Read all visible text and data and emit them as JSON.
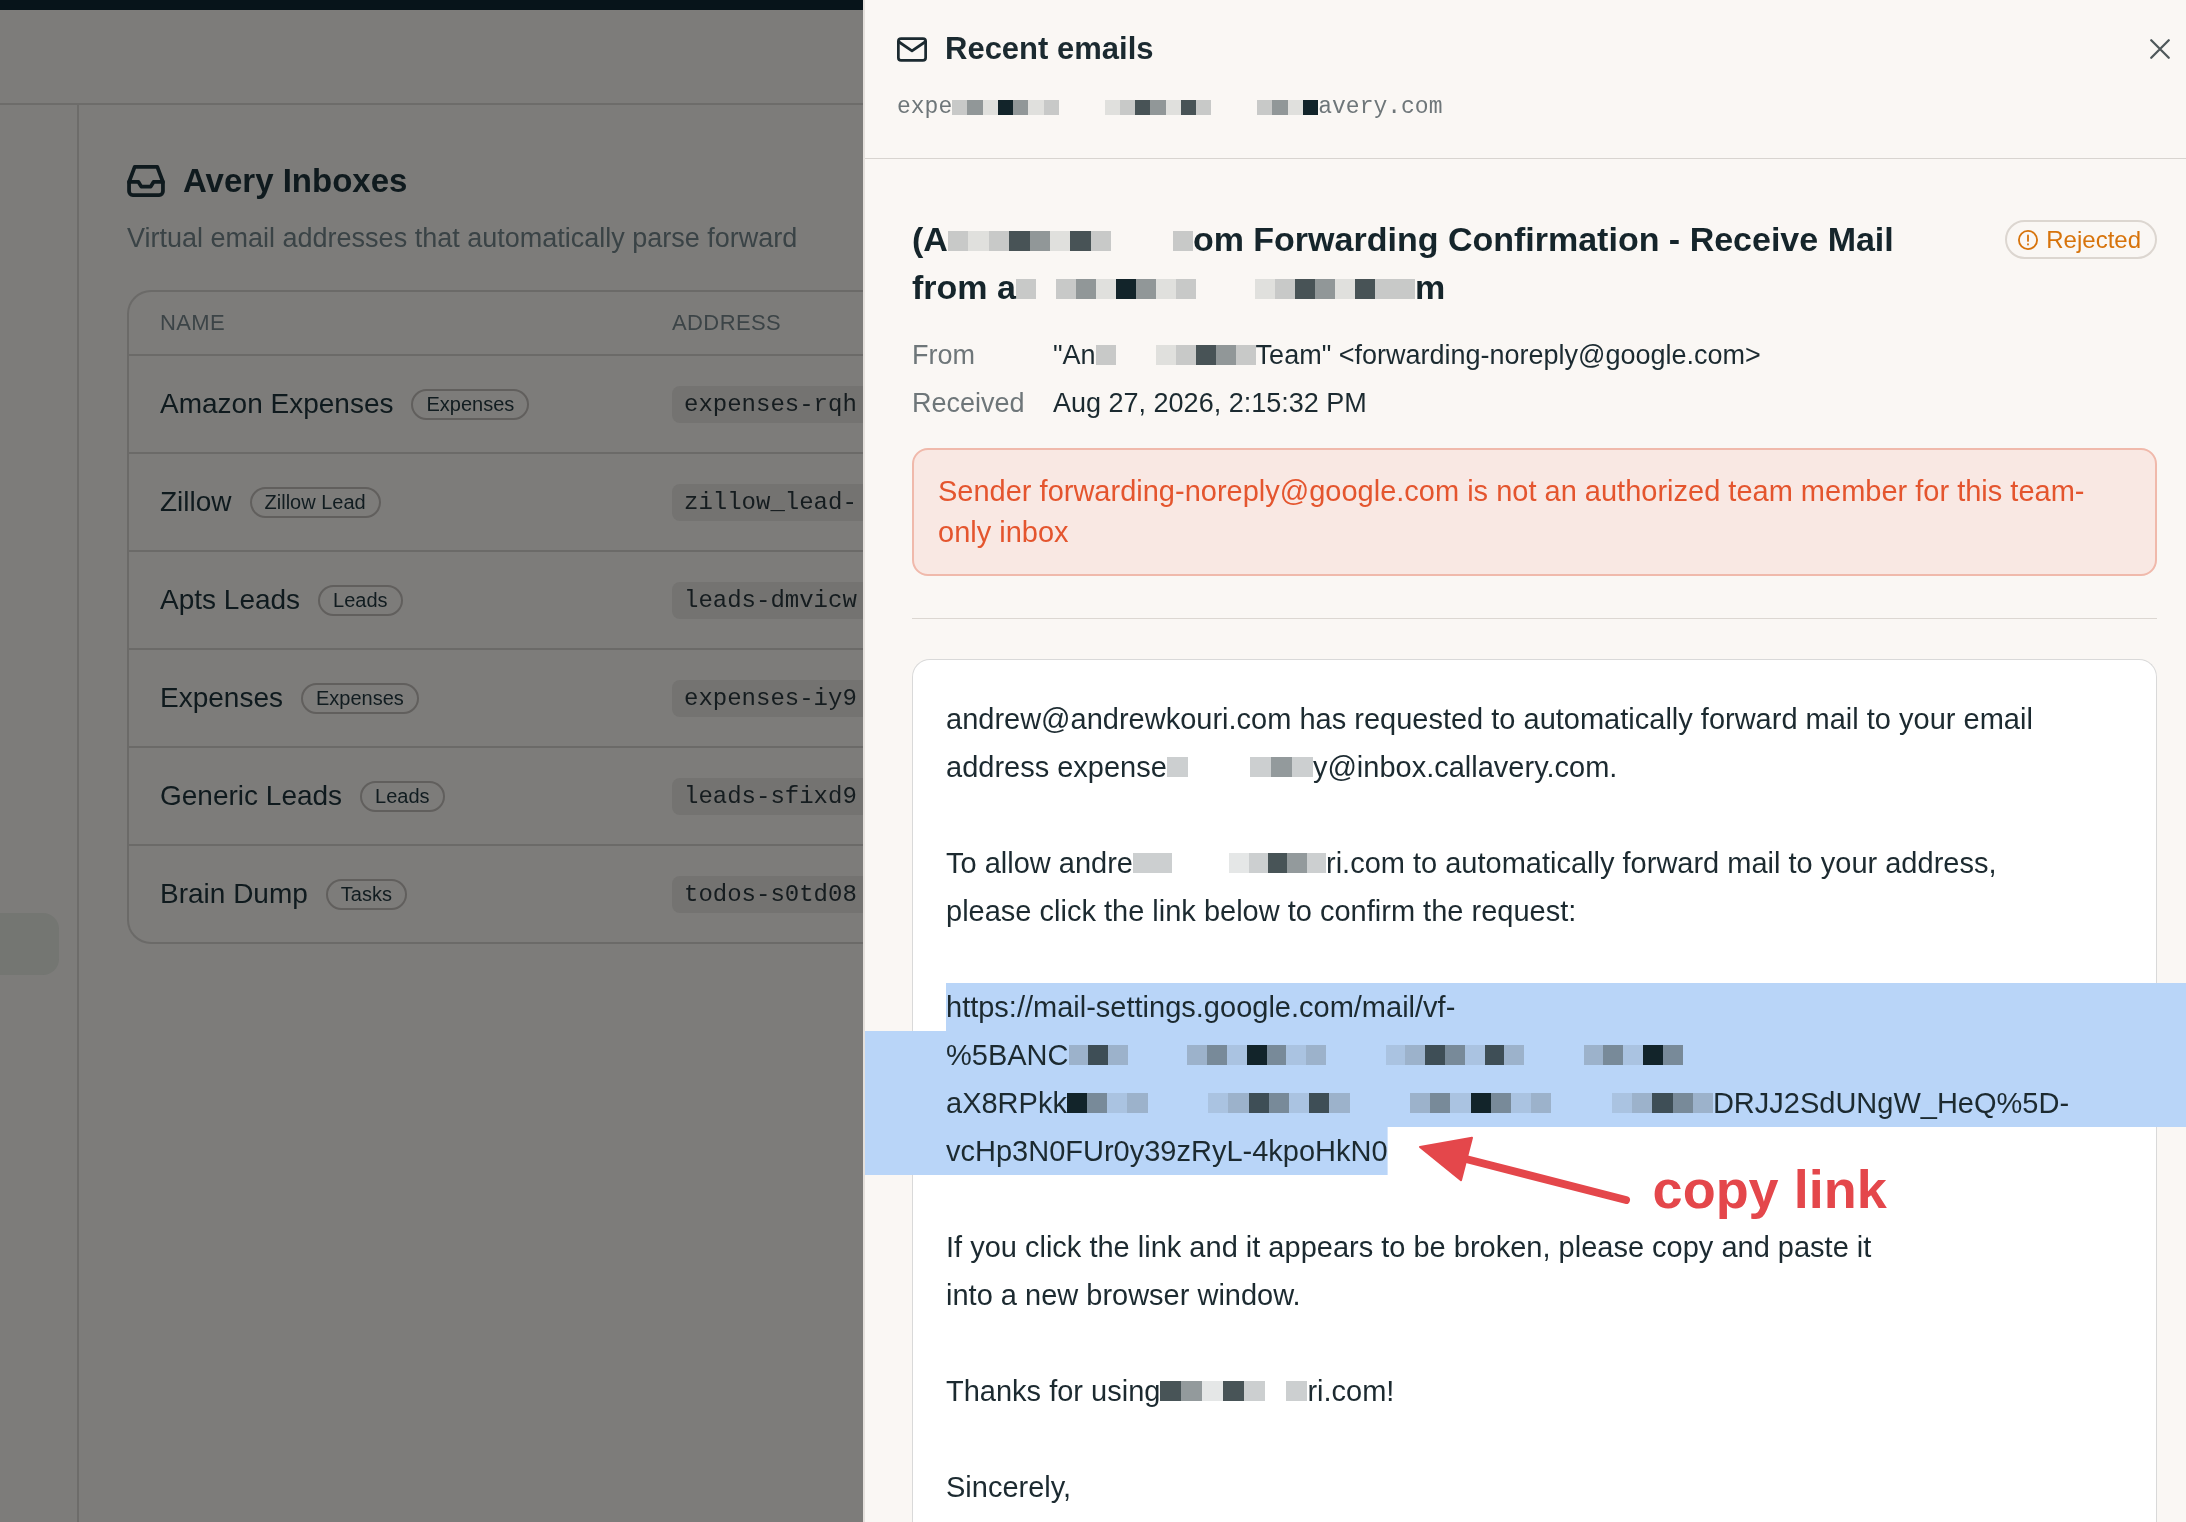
{
  "app": {
    "sidebar": {
      "items": [
        {
          "selected": true
        }
      ]
    },
    "page": {
      "title": "Avery Inboxes",
      "subtitle": "Virtual email addresses that automatically parse forward"
    },
    "table": {
      "columns": [
        "NAME",
        "ADDRESS"
      ],
      "rows": [
        {
          "name": "Amazon Expenses",
          "tag": "Expenses",
          "address": "expenses-rqh"
        },
        {
          "name": "Zillow",
          "tag": "Zillow Lead",
          "address": "zillow_lead-"
        },
        {
          "name": "Apts Leads",
          "tag": "Leads",
          "address": "leads-dmvicw"
        },
        {
          "name": "Expenses",
          "tag": "Expenses",
          "address": "expenses-iy9"
        },
        {
          "name": "Generic Leads",
          "tag": "Leads",
          "address": "leads-sfixd9"
        },
        {
          "name": "Brain Dump",
          "tag": "Tasks",
          "address": "todos-s0td08"
        }
      ]
    }
  },
  "drawer": {
    "title": "Recent emails",
    "address": [
      {
        "kind": "text",
        "text": "expe"
      },
      {
        "kind": "redacted"
      },
      {
        "kind": "text",
        "text": "avery.com"
      }
    ],
    "email": {
      "subject": [
        [
          {
            "kind": "text",
            "text": "(A"
          },
          {
            "kind": "redacted"
          },
          {
            "kind": "text",
            "text": "om Forwarding Confirmation - Receive Mail"
          }
        ],
        [
          {
            "kind": "text",
            "text": "from a"
          },
          {
            "kind": "redacted"
          },
          {
            "kind": "text",
            "text": "m"
          }
        ]
      ],
      "status": {
        "kind": "rejected",
        "label": "Rejected"
      },
      "fields": [
        {
          "label": "From",
          "value": [
            {
              "kind": "text",
              "text": "\"An"
            },
            {
              "kind": "redacted"
            },
            {
              "kind": "text",
              "text": "Team\" <forwarding-noreply@google.com>"
            }
          ]
        },
        {
          "label": "Received",
          "value": [
            {
              "kind": "text",
              "text": "Aug 27, 2026, 2:15:32 PM"
            }
          ]
        }
      ],
      "error": "Sender forwarding-noreply@google.com is not an authorized team member for this team-only inbox",
      "body": [
        {
          "kind": "text",
          "lines": [
            [
              {
                "kind": "text",
                "text": "andrew@andrewkouri.com has requested to automatically forward mail to your email"
              }
            ],
            [
              {
                "kind": "text",
                "text": "address expense"
              },
              {
                "kind": "redacted"
              },
              {
                "kind": "text",
                "text": "y@inbox.callavery.com."
              }
            ]
          ]
        },
        {
          "kind": "text",
          "lines": [
            [
              {
                "kind": "text",
                "text": "To allow andre"
              },
              {
                "kind": "redacted"
              },
              {
                "kind": "text",
                "text": "ri.com to automatically forward mail to your address,"
              }
            ],
            [
              {
                "kind": "text",
                "text": "please click the link below to confirm the request:"
              }
            ]
          ]
        },
        {
          "kind": "link",
          "selected": true,
          "lines": [
            [
              {
                "kind": "text",
                "text": "https://mail-settings.google.com/mail/vf-"
              }
            ],
            [
              {
                "kind": "text",
                "text": "%5BANC"
              },
              {
                "kind": "redacted"
              }
            ],
            [
              {
                "kind": "text",
                "text": "aX8RPkk"
              },
              {
                "kind": "redacted"
              },
              {
                "kind": "text",
                "text": "DRJJ2SdUNgW_HeQ%5D-"
              }
            ],
            [
              {
                "kind": "text",
                "text": "vcHp3N0FUr0y39zRyL-4kpoHkN0"
              }
            ]
          ]
        },
        {
          "kind": "text",
          "lines": [
            [
              {
                "kind": "text",
                "text": "If you click the link and it appears to be broken, please copy and paste it"
              }
            ],
            [
              {
                "kind": "text",
                "text": "into a new browser window."
              }
            ]
          ]
        },
        {
          "kind": "text",
          "lines": [
            [
              {
                "kind": "text",
                "text": "Thanks for using"
              },
              {
                "kind": "redacted"
              },
              {
                "kind": "text",
                "text": "ri.com!"
              }
            ]
          ]
        },
        {
          "kind": "text",
          "lines": [
            [
              {
                "kind": "text",
                "text": "Sincerely,"
              }
            ]
          ]
        }
      ]
    }
  },
  "annotation": {
    "text": "copy link"
  }
}
